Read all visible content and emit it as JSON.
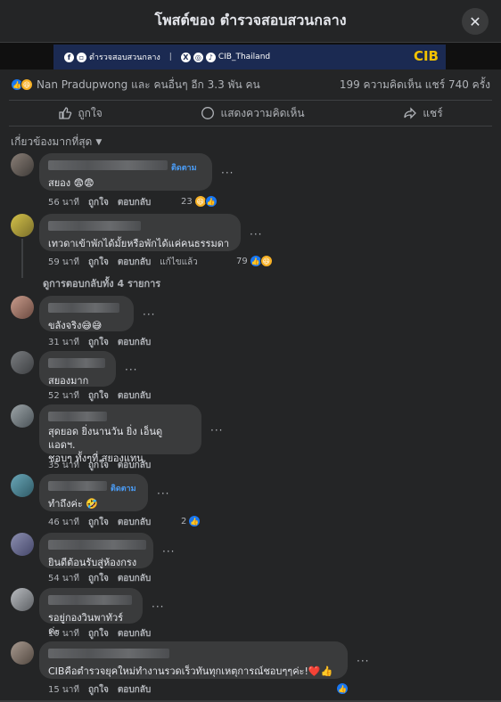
{
  "header": {
    "title": "โพสต์ของ ตำรวจสอบสวนกลาง",
    "close_icon": "close-icon"
  },
  "banner": {
    "fb_name": "ตำรวจสอบสวนกลาง",
    "handle": "CIB_Thailand",
    "logo_text": "CIB"
  },
  "reactions": {
    "names": "Nan Pradupwong และ คนอื่นๆ อีก 3.3 พัน คน",
    "stats": "199 ความคิดเห็น   แชร์ 740 ครั้ง"
  },
  "actions": {
    "like": "ถูกใจ",
    "comment": "แสดงความคิดเห็น",
    "share": "แชร์"
  },
  "sort": {
    "label": "เกี่ยวข้องมากที่สุด"
  },
  "labels": {
    "like": "ถูกใจ",
    "reply": "ตอบกลับ",
    "edited": "แก้ไขแล้ว",
    "follow": "ติดตาม"
  },
  "comments": [
    {
      "text": "สยอง 😨😨",
      "time": "56 นาที",
      "react_count": "23"
    },
    {
      "text": "เทวดาเข้าพักได้มั้ยหรือพักได้แค่คนธรรมดา",
      "time": "59 นาที",
      "react_count": "79"
    },
    {
      "text": "ขลังจริง😅😅",
      "time": "31 นาที"
    },
    {
      "text": "สยองมาก",
      "time": "52 นาที"
    },
    {
      "text_line1": "สุดยอด ยิ่งนานวัน ยิ่ง เอ็นดู แอดฯ.",
      "text_line2": "ชอบๆ ทั้งๆที่ สยองแทน.",
      "time": "35 นาที"
    },
    {
      "text": "ทำถึงค่ะ 🤣",
      "time": "46 นาที",
      "react_count": "2"
    },
    {
      "text": "ยินดีต้อนรับสู่ห้องกรง",
      "time": "54 นาที"
    },
    {
      "text": "รอยู่กองวินพาทัวร์ค่ะ",
      "time": "10 นาที"
    },
    {
      "text": "CIBคือตำรวจยุคใหม่ทำงานรวดเร็วทันทุกเหตุการณ์ชอบๆๆค่ะ!❤️👍",
      "time": "15 นาที"
    }
  ],
  "more_replies": "ดูการตอบกลับทั้ง 4 รายการ"
}
